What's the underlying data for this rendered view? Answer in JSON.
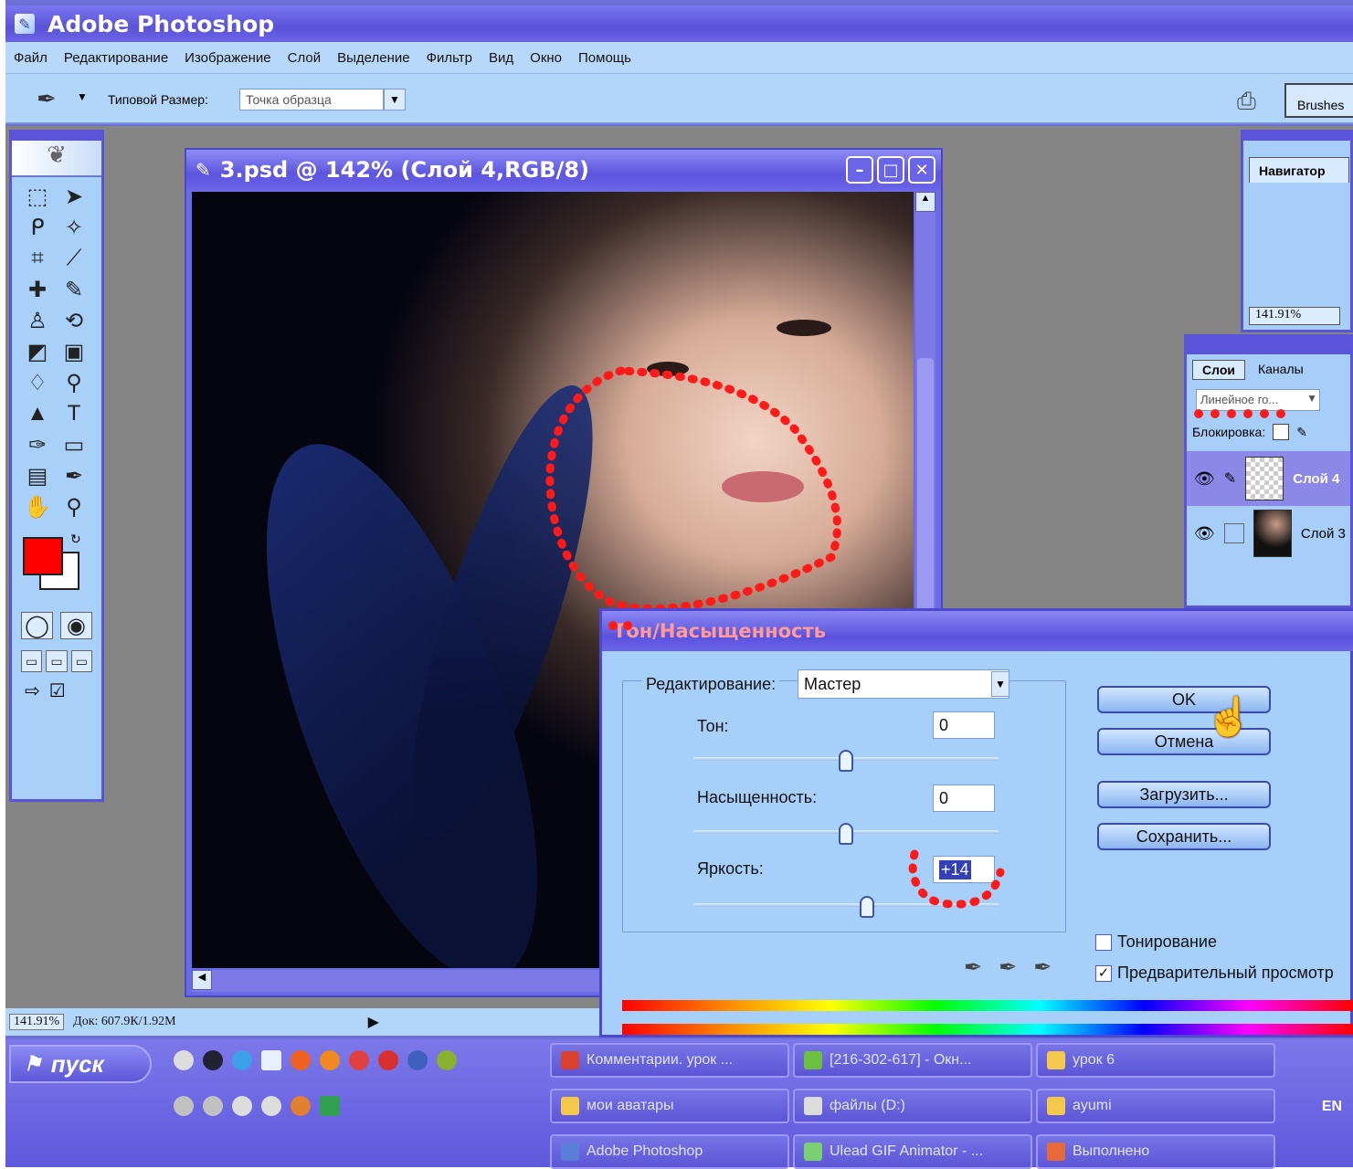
{
  "app": {
    "title": "Adobe Photoshop"
  },
  "menu": [
    "Файл",
    "Редактирование",
    "Изображение",
    "Слой",
    "Выделение",
    "Фильтр",
    "Вид",
    "Окно",
    "Помощь"
  ],
  "options": {
    "sample_label": "Типовой Размер:",
    "sample_value": "Точка образца",
    "brushes": "Brushes"
  },
  "document": {
    "title": "3.psd @ 142% (Слой 4,RGB/8)"
  },
  "status": {
    "zoom": "141.91%",
    "doc": "Док: 607.9К/1.92М"
  },
  "navigator": {
    "tab": "Навигатор",
    "zoom": "141.91%"
  },
  "layers": {
    "tabs": [
      "Слои",
      "Каналы"
    ],
    "blend_mode": "Линейное го...",
    "lock_label": "Блокировка:",
    "items": [
      {
        "name": "Слой 4"
      },
      {
        "name": "Слой 3"
      }
    ]
  },
  "dialog": {
    "title": "Тон/Насыщенность",
    "edit_label": "Редактирование:",
    "edit_value": "Мастер",
    "hue_label": "Тон:",
    "hue_value": "0",
    "saturation_label": "Насыщенность:",
    "saturation_value": "0",
    "lightness_label": "Яркость:",
    "lightness_value": "+14",
    "ok": "OK",
    "cancel": "Отмена",
    "load": "Загрузить...",
    "save": "Сохранить...",
    "colorize": "Тонирование",
    "colorize_checked": false,
    "preview": "Предварительный просмотр",
    "preview_checked": true,
    "hue_slider": 0.5,
    "saturation_slider": 0.5,
    "lightness_slider": 0.57
  },
  "taskbar": {
    "start": "пуск",
    "tasks": [
      {
        "label": "Комментарии. урок ...",
        "color": "#d84030"
      },
      {
        "label": "[216-302-617] - Окн...",
        "color": "#6cc040"
      },
      {
        "label": "урок 6",
        "color": "#f4c84a"
      },
      {
        "label": "мои аватары",
        "color": "#f4c84a"
      },
      {
        "label": "файлы (D:)",
        "color": "#dcdcdc"
      },
      {
        "label": "ayumi",
        "color": "#f4c84a"
      },
      {
        "label": "Adobe Photoshop",
        "color": "#5a7fd8"
      },
      {
        "label": "Ulead GIF Animator - ...",
        "color": "#7ad070"
      },
      {
        "label": "Выполнено",
        "color": "#e86a3a"
      }
    ],
    "lang": "EN"
  },
  "colors": {
    "foreground": "#ff0000",
    "background": "#ffffff"
  }
}
